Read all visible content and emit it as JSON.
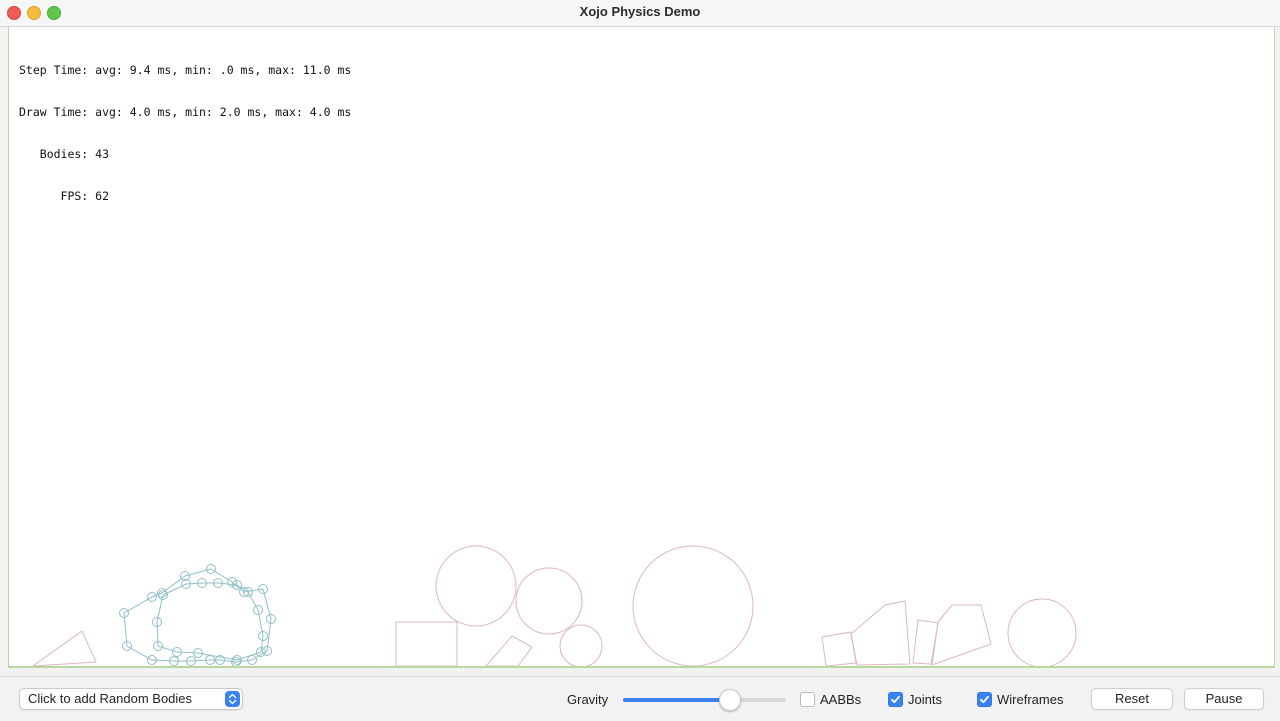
{
  "window": {
    "title": "Xojo Physics Demo"
  },
  "stats": {
    "lines": [
      "Step Time: avg: 9.4 ms, min: .0 ms, max: 11.0 ms",
      "Draw Time: avg: 4.0 ms, min: 2.0 ms, max: 4.0 ms",
      "   Bodies: 43",
      "      FPS: 62"
    ]
  },
  "colors": {
    "body_stroke": "#dcb8b8",
    "soft_body_stroke": "#8fbfc9",
    "ground": "#b7d8a0",
    "accent": "#3b82f0"
  },
  "controls": {
    "add_bodies_popup": "Click to add Random Bodies",
    "gravity_label": "Gravity",
    "gravity_level": 0.65,
    "aabbs_label": "AABBs",
    "aabbs_checked": false,
    "joints_label": "Joints",
    "joints_checked": true,
    "wireframes_label": "Wireframes",
    "wireframes_checked": true,
    "reset_label": "Reset",
    "pause_label": "Pause"
  }
}
